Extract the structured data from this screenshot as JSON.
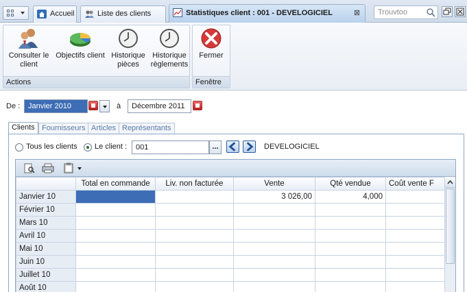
{
  "topbar": {
    "tabs": [
      {
        "label": "Accueil",
        "icon": "home-icon"
      },
      {
        "label": "Liste des clients",
        "icon": "clients-icon"
      },
      {
        "label": "Statistiques client : 001 - DEVELOGICIEL",
        "icon": "chart-icon"
      }
    ],
    "search_placeholder": "Trouvtoo"
  },
  "ribbon": {
    "actions_label": "Actions",
    "fenetre_label": "Fenêtre",
    "buttons": [
      {
        "line1": "Consulter le",
        "line2": "client",
        "icon": "users-icon"
      },
      {
        "line1": "Objectifs client",
        "line2": "",
        "icon": "pie-chart-icon"
      },
      {
        "line1": "Historique",
        "line2": "pièces",
        "icon": "clock-icon"
      },
      {
        "line1": "Historique",
        "line2": "règlements",
        "icon": "clock-icon"
      }
    ],
    "close": {
      "label": "Fermer",
      "icon": "close-icon"
    }
  },
  "period": {
    "from_label": "De :",
    "from_value": "Janvier 2010",
    "to_label": "à",
    "to_value": "Décembre 2011"
  },
  "subtabs": [
    "Clients",
    "Fournisseurs",
    "Articles",
    "Représentants"
  ],
  "filter": {
    "all_label": "Tous les clients",
    "one_label": "Le client :",
    "client_code": "001",
    "client_name": "DEVELOGICIEL",
    "ellipsis": "..."
  },
  "table": {
    "columns": [
      "Total en commande",
      "Liv. non facturée",
      "Vente",
      "Qté vendue",
      "Coût vente F"
    ],
    "rows": [
      {
        "month": "Janvier 10",
        "cells": [
          "",
          "",
          "3 026,00",
          "4,000",
          ""
        ]
      },
      {
        "month": "Février 10",
        "cells": [
          "",
          "",
          "",
          "",
          ""
        ]
      },
      {
        "month": "Mars 10",
        "cells": [
          "",
          "",
          "",
          "",
          ""
        ]
      },
      {
        "month": "Avril 10",
        "cells": [
          "",
          "",
          "",
          "",
          ""
        ]
      },
      {
        "month": "Mai 10",
        "cells": [
          "",
          "",
          "",
          "",
          ""
        ]
      },
      {
        "month": "Juin 10",
        "cells": [
          "",
          "",
          "",
          "",
          ""
        ]
      },
      {
        "month": "Juillet 10",
        "cells": [
          "",
          "",
          "",
          "",
          ""
        ]
      },
      {
        "month": "Août 10",
        "cells": [
          "",
          "",
          "",
          "",
          ""
        ]
      }
    ]
  },
  "colors": {
    "accent": "#3d6db5",
    "close_red": "#d43a3a"
  }
}
